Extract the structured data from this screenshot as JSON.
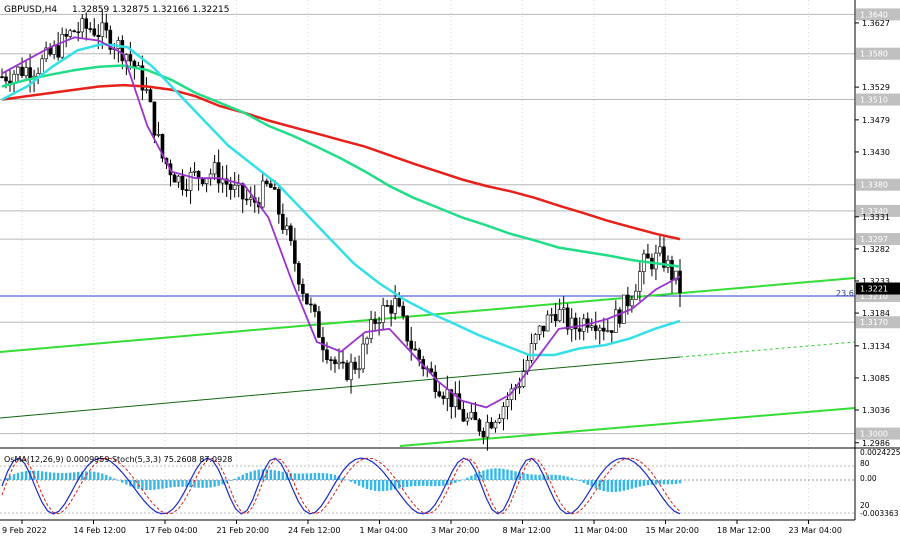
{
  "header": {
    "symbol": "GBPUSD,H4",
    "ohlc": "1.32859 1.32875 1.32166 1.32215"
  },
  "price_axis": {
    "ticks": [
      "1.3627",
      "1.3529",
      "1.3479",
      "1.3430",
      "1.3331",
      "1.3282",
      "1.3233",
      "1.3184",
      "1.3134",
      "1.3085",
      "1.3036",
      "1.2986"
    ],
    "levels": [
      {
        "label": "1.3640",
        "value": 1.364,
        "color": "#c0c0c0"
      },
      {
        "label": "1.3580",
        "value": 1.358,
        "color": "#c0c0c0"
      },
      {
        "label": "1.3510",
        "value": 1.351,
        "color": "#c0c0c0"
      },
      {
        "label": "1.3380",
        "value": 1.338,
        "color": "#c0c0c0"
      },
      {
        "label": "1.3340",
        "value": 1.334,
        "color": "#c0c0c0"
      },
      {
        "label": "1.3297",
        "value": 1.3297,
        "color": "#c0c0c0"
      },
      {
        "label": "1.3210",
        "value": 1.321,
        "color": "#c0c0c0"
      },
      {
        "label": "1.3170",
        "value": 1.317,
        "color": "#c0c0c0"
      },
      {
        "label": "1.3000",
        "value": 1.3,
        "color": "#c0c0c0"
      }
    ],
    "current": {
      "label": "1.3221",
      "value": 1.32215,
      "color": "#000000"
    },
    "range": [
      1.2978,
      1.3662
    ]
  },
  "fibo_label": "23.6",
  "time_axis": [
    "9 Feb 2022",
    "14 Feb 12:00",
    "17 Feb 04:00",
    "21 Feb 20:00",
    "24 Feb 12:00",
    "1 Mar 04:00",
    "3 Mar 20:00",
    "8 Mar 12:00",
    "11 Mar 04:00",
    "15 Mar 20:00",
    "18 Mar 12:00",
    "23 Mar 04:00"
  ],
  "sub_window": {
    "label": "OsMA(12,26,9) 0.0009959  Stoch(5,3,3) 75.2608 87.0928",
    "ticks": [
      "0.0024225",
      "80",
      "0.00",
      "20",
      "-0.003363"
    ]
  },
  "chart_data": {
    "type": "line",
    "title": "GBPUSD,H4",
    "x": [
      "9 Feb 2022",
      "14 Feb 12:00",
      "17 Feb 04:00",
      "21 Feb 20:00",
      "24 Feb 12:00",
      "1 Mar 04:00",
      "3 Mar 20:00",
      "8 Mar 12:00",
      "11 Mar 04:00",
      "15 Mar 20:00",
      "18 Mar 12:00",
      "23 Mar 04:00"
    ],
    "ylim": [
      1.2978,
      1.3662
    ],
    "grid": true,
    "price": [
      1.3545,
      1.3555,
      1.356,
      1.3585,
      1.3615,
      1.362,
      1.3605,
      1.358,
      1.353,
      1.342,
      1.3385,
      1.3395,
      1.34,
      1.337,
      1.335,
      1.338,
      1.33,
      1.321,
      1.314,
      1.309,
      1.311,
      1.318,
      1.32,
      1.313,
      1.309,
      1.306,
      1.302,
      1.301,
      1.304,
      1.308,
      1.315,
      1.319,
      1.316,
      1.318,
      1.316,
      1.32,
      1.326,
      1.327,
      1.32215
    ],
    "ema200": [
      1.351,
      1.3515,
      1.352,
      1.3525,
      1.353,
      1.3532,
      1.353,
      1.3525,
      1.3515,
      1.35,
      1.349,
      1.3478,
      1.3468,
      1.3458,
      1.3448,
      1.3438,
      1.3425,
      1.3412,
      1.34,
      1.3388,
      1.3378,
      1.337,
      1.336,
      1.3348,
      1.3337,
      1.3325,
      1.3315,
      1.3305,
      1.3297
    ],
    "ema144": [
      1.353,
      1.354,
      1.3548,
      1.3555,
      1.356,
      1.3562,
      1.3555,
      1.354,
      1.352,
      1.3505,
      1.349,
      1.347,
      1.3455,
      1.3438,
      1.342,
      1.34,
      1.3378,
      1.336,
      1.3345,
      1.333,
      1.3318,
      1.3305,
      1.3295,
      1.3284,
      1.3278,
      1.3272,
      1.3265,
      1.326,
      1.3255
    ],
    "ema50": [
      1.351,
      1.353,
      1.356,
      1.3585,
      1.3595,
      1.359,
      1.356,
      1.352,
      1.348,
      1.344,
      1.341,
      1.338,
      1.334,
      1.33,
      1.326,
      1.323,
      1.3205,
      1.3185,
      1.3168,
      1.315,
      1.3135,
      1.312,
      1.312,
      1.313,
      1.3135,
      1.3145,
      1.316,
      1.3172
    ],
    "ema21": [
      1.355,
      1.357,
      1.359,
      1.3605,
      1.36,
      1.358,
      1.347,
      1.34,
      1.339,
      1.339,
      1.338,
      1.333,
      1.323,
      1.314,
      1.3125,
      1.3155,
      1.316,
      1.312,
      1.308,
      1.305,
      1.304,
      1.306,
      1.311,
      1.316,
      1.3165,
      1.3175,
      1.319,
      1.322,
      1.324
    ],
    "levels": [
      1.364,
      1.358,
      1.351,
      1.338,
      1.334,
      1.3297,
      1.321,
      1.317,
      1.3
    ],
    "channel_upper": [
      [
        1.312,
        1.324
      ]
    ],
    "channel_lower": [
      [
        1.3,
        1.312
      ]
    ]
  }
}
